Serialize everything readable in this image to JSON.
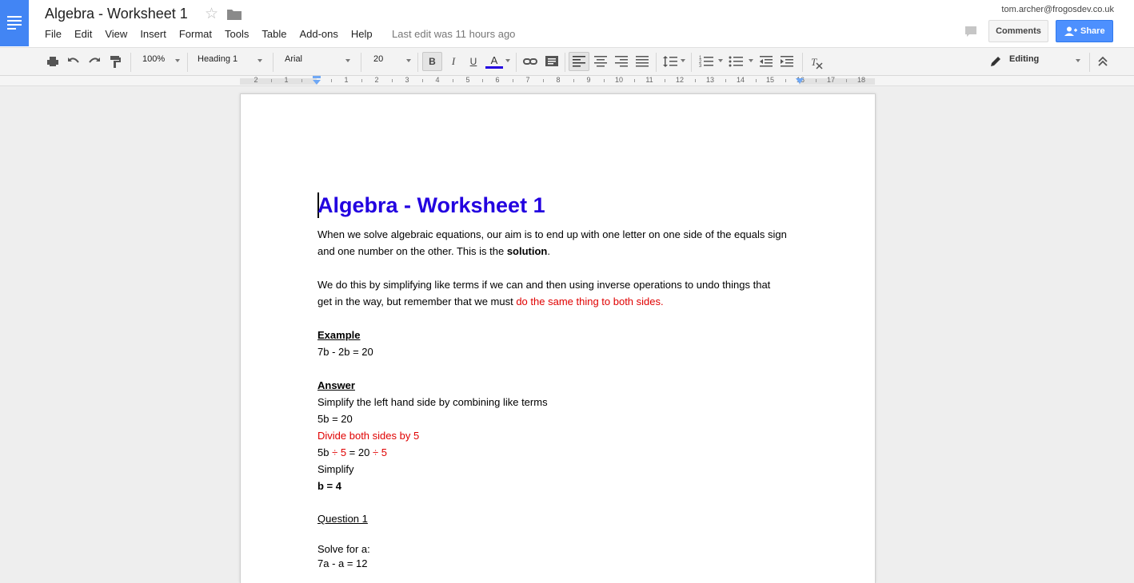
{
  "app": {
    "title": "Algebra - Worksheet 1",
    "account_email": "tom.archer@frogosdev.co.uk",
    "last_edit": "Last edit was 11 hours ago",
    "comments_label": "Comments",
    "share_label": "Share",
    "accent_color": "#4285f4"
  },
  "menu": [
    "File",
    "Edit",
    "View",
    "Insert",
    "Format",
    "Tools",
    "Table",
    "Add-ons",
    "Help"
  ],
  "toolbar": {
    "zoom": "100%",
    "style": "Heading 1",
    "font": "Arial",
    "font_size": "20",
    "bold_label": "B",
    "italic_label": "I",
    "underline_label": "U",
    "text_color_label": "A",
    "text_color": "#2200e0",
    "mode": "Editing"
  },
  "ruler": {
    "labels": [
      "2",
      "1",
      "1",
      "2",
      "3",
      "4",
      "5",
      "6",
      "7",
      "8",
      "9",
      "10",
      "11",
      "12",
      "13",
      "14",
      "15",
      "16",
      "17",
      "18"
    ]
  },
  "document": {
    "heading": "Algebra - Worksheet 1",
    "para1_line1": "When we solve algebraic equations, our aim is to end up with one letter on one side of the equals sign",
    "para1_line2_pre": "and one number on the other.  This is the ",
    "para1_line2_bold": "solution",
    "para1_line2_post": ".",
    "para2_line1": "We do this by simplifying like terms if we can and then using inverse operations to undo things that",
    "para2_line2_pre": "get in the way, but remember that we must ",
    "para2_line2_red": "do the same thing to both sides.",
    "example_heading": "Example",
    "example_eq": "7b - 2b = 20",
    "answer_heading": "Answer",
    "answer_step1": "Simplify the left hand side by combining like terms",
    "answer_step2": "5b = 20",
    "answer_step3": "Divide both sides by 5",
    "answer_step4_a": "5b ",
    "answer_step4_b": "÷ 5",
    "answer_step4_c": " = 20 ",
    "answer_step4_d": "÷ 5",
    "answer_step5": "Simplify",
    "answer_result": "b = 4",
    "question_heading": "Question 1",
    "question_prompt": "Solve for a:",
    "question_eq": "7a - a = 12"
  }
}
